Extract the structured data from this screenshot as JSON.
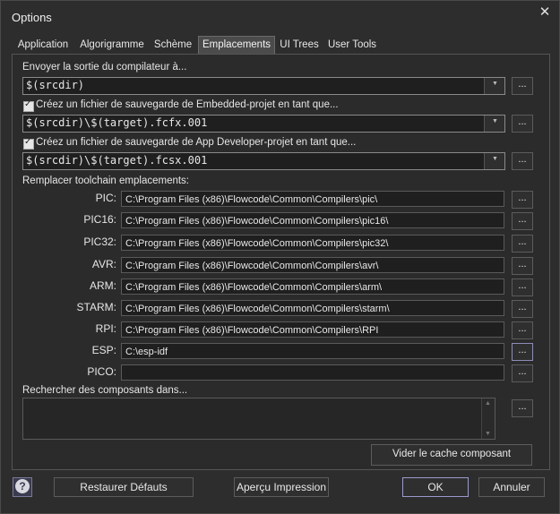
{
  "window": {
    "title": "Options",
    "close": "✕"
  },
  "tabs": [
    {
      "label": "Application"
    },
    {
      "label": "Algorigramme"
    },
    {
      "label": "Schème"
    },
    {
      "label": "Emplacements"
    },
    {
      "label": "UI Trees"
    },
    {
      "label": "User Tools"
    }
  ],
  "active_tab": "Emplacements",
  "output": {
    "label": "Envoyer la sortie du compilateur à...",
    "value": "$(srcdir)"
  },
  "embedded_backup": {
    "checked": true,
    "label": "Créez un fichier de sauvegarde de Embedded-projet en tant que...",
    "value": "$(srcdir)\\$(target).fcfx.001"
  },
  "appdev_backup": {
    "checked": true,
    "label": "Créez un fichier de sauvegarde de App Developer-projet en tant que...",
    "value": "$(srcdir)\\$(target).fcsx.001"
  },
  "toolchain": {
    "label": "Remplacer toolchain emplacements:",
    "rows": [
      {
        "name": "PIC:",
        "path": "C:\\Program Files (x86)\\Flowcode\\Common\\Compilers\\pic\\"
      },
      {
        "name": "PIC16:",
        "path": "C:\\Program Files (x86)\\Flowcode\\Common\\Compilers\\pic16\\"
      },
      {
        "name": "PIC32:",
        "path": "C:\\Program Files (x86)\\Flowcode\\Common\\Compilers\\pic32\\"
      },
      {
        "name": "AVR:",
        "path": "C:\\Program Files (x86)\\Flowcode\\Common\\Compilers\\avr\\"
      },
      {
        "name": "ARM:",
        "path": "C:\\Program Files (x86)\\Flowcode\\Common\\Compilers\\arm\\"
      },
      {
        "name": "STARM:",
        "path": "C:\\Program Files (x86)\\Flowcode\\Common\\Compilers\\starm\\"
      },
      {
        "name": "RPI:",
        "path": "C:\\Program Files (x86)\\Flowcode\\Common\\Compilers\\RPI"
      },
      {
        "name": "ESP:",
        "path": "C:\\esp-idf"
      },
      {
        "name": "PICO:",
        "path": ""
      }
    ]
  },
  "components": {
    "label": "Rechercher des composants dans...",
    "clear_cache": "Vider le cache composant"
  },
  "browse_label": "...",
  "footer": {
    "restore": "Restaurer Défauts",
    "preview": "Aperçu Impression",
    "ok": "OK",
    "cancel": "Annuler",
    "help": "?"
  },
  "colors": {
    "background": "#2d2d2d",
    "accent_border": "#9a9ad0",
    "text": "#e8e8e8"
  }
}
